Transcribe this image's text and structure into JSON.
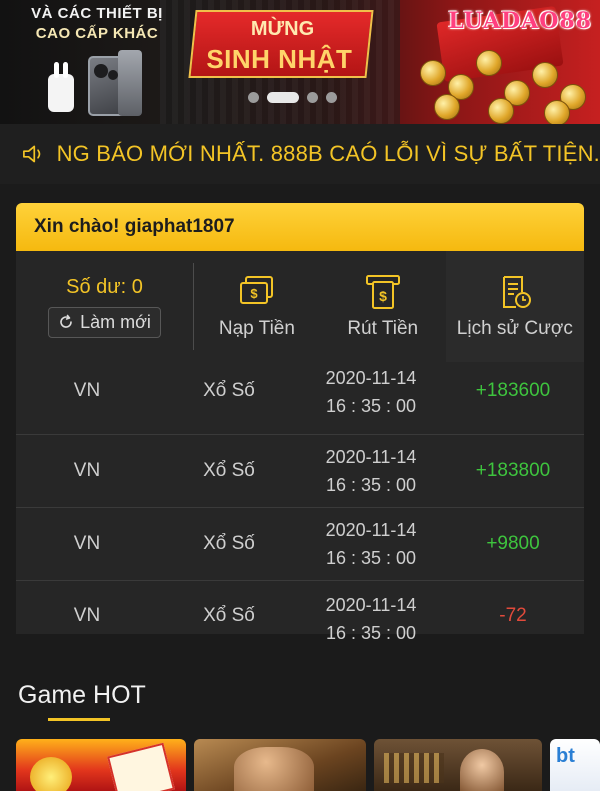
{
  "banner": {
    "left_line1": "VÀ CÁC THIẾT BỊ",
    "left_line2": "CAO CẤP KHÁC",
    "ribbon_line1": "MỪNG",
    "ribbon_line2": "SINH NHẬT",
    "watermark": "LUADAO88",
    "slide_count": 4,
    "active_slide": 2
  },
  "notice": {
    "icon": "speaker-icon",
    "text": "NG BÁO MỚI NHẤT. 888B CAÓ LỖI VÌ SỰ BẤT TIỆN."
  },
  "greeting": {
    "text": "Xin chào! giaphat1807"
  },
  "wallet": {
    "balance_label": "Số dư: 0",
    "refresh_label": "Làm mới",
    "actions": [
      {
        "label": "Nạp Tiền",
        "icon": "deposit-icon"
      },
      {
        "label": "Rút Tiền",
        "icon": "withdraw-icon"
      },
      {
        "label": "Lịch sử Cược",
        "icon": "bet-history-icon"
      }
    ]
  },
  "transactions": [
    {
      "region": "VN",
      "game": "Xổ Số",
      "date": "2020-11-14",
      "time": "16 : 35 : 00",
      "amount": "+183600"
    },
    {
      "region": "VN",
      "game": "Xổ Số",
      "date": "2020-11-14",
      "time": "16 : 35 : 00",
      "amount": "+183800"
    },
    {
      "region": "VN",
      "game": "Xổ Số",
      "date": "2020-11-14",
      "time": "16 : 35 : 00",
      "amount": "+9800"
    },
    {
      "region": "VN",
      "game": "Xổ Số",
      "date": "2020-11-14",
      "time": "16 : 35 : 00",
      "amount": "-72"
    }
  ],
  "game_hot": {
    "title": "Game HOT",
    "tile_d_text": "bt"
  },
  "colors": {
    "accent": "#f3c426",
    "positive": "#3ec43e",
    "negative": "#e24a3b",
    "background": "#1b1b1b"
  }
}
